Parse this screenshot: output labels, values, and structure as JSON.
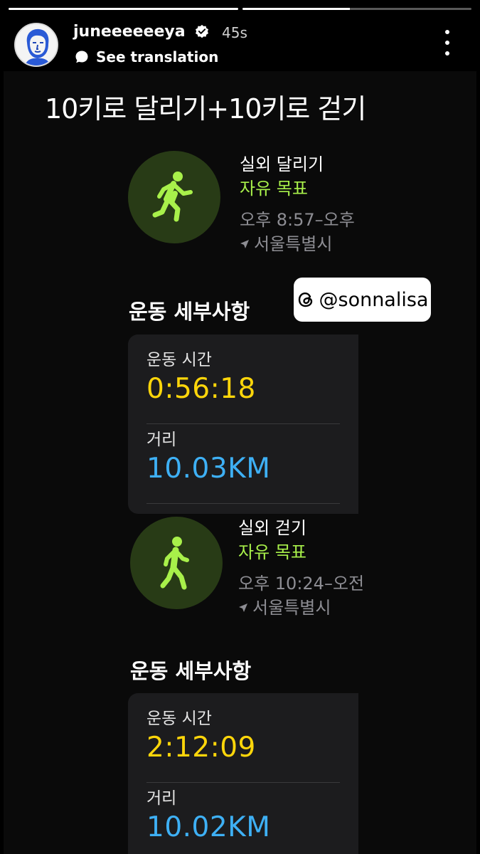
{
  "story": {
    "progress": [
      1.0,
      0.47
    ],
    "username": "juneeeeeeya",
    "time_ago": "45s",
    "see_translation": "See translation"
  },
  "screenshot": {
    "title": "10키로 달리기+10키로 걷기",
    "workouts": [
      {
        "icon": "running-figure-icon",
        "name": "실외 달리기",
        "goal": "자유 목표",
        "time": "오후 8:57–오후",
        "location": "서울특별시",
        "details_title": "운동 세부사항",
        "duration_label": "운동 시간",
        "duration": "0:56:18",
        "distance_label": "거리",
        "distance": "10.03KM"
      },
      {
        "icon": "walking-figure-icon",
        "name": "실외 걷기",
        "goal": "자유 목표",
        "time": "오후 10:24–오전",
        "location": "서울특별시",
        "details_title": "운동 세부사항",
        "duration_label": "운동 시간",
        "duration": "2:12:09",
        "distance_label": "거리",
        "distance": "10.02KM"
      }
    ]
  },
  "sticker": {
    "text": "@sonnalisa",
    "icon": "threads-icon"
  },
  "colors": {
    "goal_green": "#a8f04a",
    "duration_yellow": "#ffd60a",
    "distance_blue": "#3eb0f5",
    "card_bg": "#1c1c1e"
  }
}
